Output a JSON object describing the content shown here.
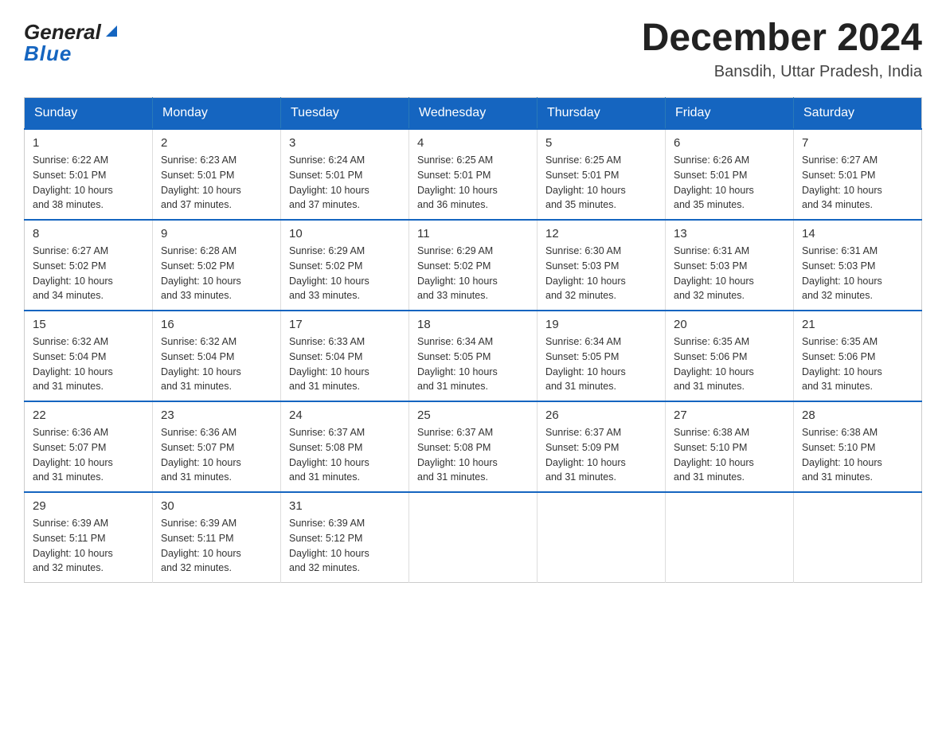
{
  "header": {
    "title": "December 2024",
    "subtitle": "Bansdih, Uttar Pradesh, India",
    "logo_general": "General",
    "logo_blue": "Blue"
  },
  "days_of_week": [
    "Sunday",
    "Monday",
    "Tuesday",
    "Wednesday",
    "Thursday",
    "Friday",
    "Saturday"
  ],
  "weeks": [
    [
      {
        "day": "1",
        "sunrise": "6:22 AM",
        "sunset": "5:01 PM",
        "daylight": "10 hours and 38 minutes."
      },
      {
        "day": "2",
        "sunrise": "6:23 AM",
        "sunset": "5:01 PM",
        "daylight": "10 hours and 37 minutes."
      },
      {
        "day": "3",
        "sunrise": "6:24 AM",
        "sunset": "5:01 PM",
        "daylight": "10 hours and 37 minutes."
      },
      {
        "day": "4",
        "sunrise": "6:25 AM",
        "sunset": "5:01 PM",
        "daylight": "10 hours and 36 minutes."
      },
      {
        "day": "5",
        "sunrise": "6:25 AM",
        "sunset": "5:01 PM",
        "daylight": "10 hours and 35 minutes."
      },
      {
        "day": "6",
        "sunrise": "6:26 AM",
        "sunset": "5:01 PM",
        "daylight": "10 hours and 35 minutes."
      },
      {
        "day": "7",
        "sunrise": "6:27 AM",
        "sunset": "5:01 PM",
        "daylight": "10 hours and 34 minutes."
      }
    ],
    [
      {
        "day": "8",
        "sunrise": "6:27 AM",
        "sunset": "5:02 PM",
        "daylight": "10 hours and 34 minutes."
      },
      {
        "day": "9",
        "sunrise": "6:28 AM",
        "sunset": "5:02 PM",
        "daylight": "10 hours and 33 minutes."
      },
      {
        "day": "10",
        "sunrise": "6:29 AM",
        "sunset": "5:02 PM",
        "daylight": "10 hours and 33 minutes."
      },
      {
        "day": "11",
        "sunrise": "6:29 AM",
        "sunset": "5:02 PM",
        "daylight": "10 hours and 33 minutes."
      },
      {
        "day": "12",
        "sunrise": "6:30 AM",
        "sunset": "5:03 PM",
        "daylight": "10 hours and 32 minutes."
      },
      {
        "day": "13",
        "sunrise": "6:31 AM",
        "sunset": "5:03 PM",
        "daylight": "10 hours and 32 minutes."
      },
      {
        "day": "14",
        "sunrise": "6:31 AM",
        "sunset": "5:03 PM",
        "daylight": "10 hours and 32 minutes."
      }
    ],
    [
      {
        "day": "15",
        "sunrise": "6:32 AM",
        "sunset": "5:04 PM",
        "daylight": "10 hours and 31 minutes."
      },
      {
        "day": "16",
        "sunrise": "6:32 AM",
        "sunset": "5:04 PM",
        "daylight": "10 hours and 31 minutes."
      },
      {
        "day": "17",
        "sunrise": "6:33 AM",
        "sunset": "5:04 PM",
        "daylight": "10 hours and 31 minutes."
      },
      {
        "day": "18",
        "sunrise": "6:34 AM",
        "sunset": "5:05 PM",
        "daylight": "10 hours and 31 minutes."
      },
      {
        "day": "19",
        "sunrise": "6:34 AM",
        "sunset": "5:05 PM",
        "daylight": "10 hours and 31 minutes."
      },
      {
        "day": "20",
        "sunrise": "6:35 AM",
        "sunset": "5:06 PM",
        "daylight": "10 hours and 31 minutes."
      },
      {
        "day": "21",
        "sunrise": "6:35 AM",
        "sunset": "5:06 PM",
        "daylight": "10 hours and 31 minutes."
      }
    ],
    [
      {
        "day": "22",
        "sunrise": "6:36 AM",
        "sunset": "5:07 PM",
        "daylight": "10 hours and 31 minutes."
      },
      {
        "day": "23",
        "sunrise": "6:36 AM",
        "sunset": "5:07 PM",
        "daylight": "10 hours and 31 minutes."
      },
      {
        "day": "24",
        "sunrise": "6:37 AM",
        "sunset": "5:08 PM",
        "daylight": "10 hours and 31 minutes."
      },
      {
        "day": "25",
        "sunrise": "6:37 AM",
        "sunset": "5:08 PM",
        "daylight": "10 hours and 31 minutes."
      },
      {
        "day": "26",
        "sunrise": "6:37 AM",
        "sunset": "5:09 PM",
        "daylight": "10 hours and 31 minutes."
      },
      {
        "day": "27",
        "sunrise": "6:38 AM",
        "sunset": "5:10 PM",
        "daylight": "10 hours and 31 minutes."
      },
      {
        "day": "28",
        "sunrise": "6:38 AM",
        "sunset": "5:10 PM",
        "daylight": "10 hours and 31 minutes."
      }
    ],
    [
      {
        "day": "29",
        "sunrise": "6:39 AM",
        "sunset": "5:11 PM",
        "daylight": "10 hours and 32 minutes."
      },
      {
        "day": "30",
        "sunrise": "6:39 AM",
        "sunset": "5:11 PM",
        "daylight": "10 hours and 32 minutes."
      },
      {
        "day": "31",
        "sunrise": "6:39 AM",
        "sunset": "5:12 PM",
        "daylight": "10 hours and 32 minutes."
      },
      null,
      null,
      null,
      null
    ]
  ],
  "labels": {
    "sunrise": "Sunrise:",
    "sunset": "Sunset:",
    "daylight": "Daylight:"
  }
}
